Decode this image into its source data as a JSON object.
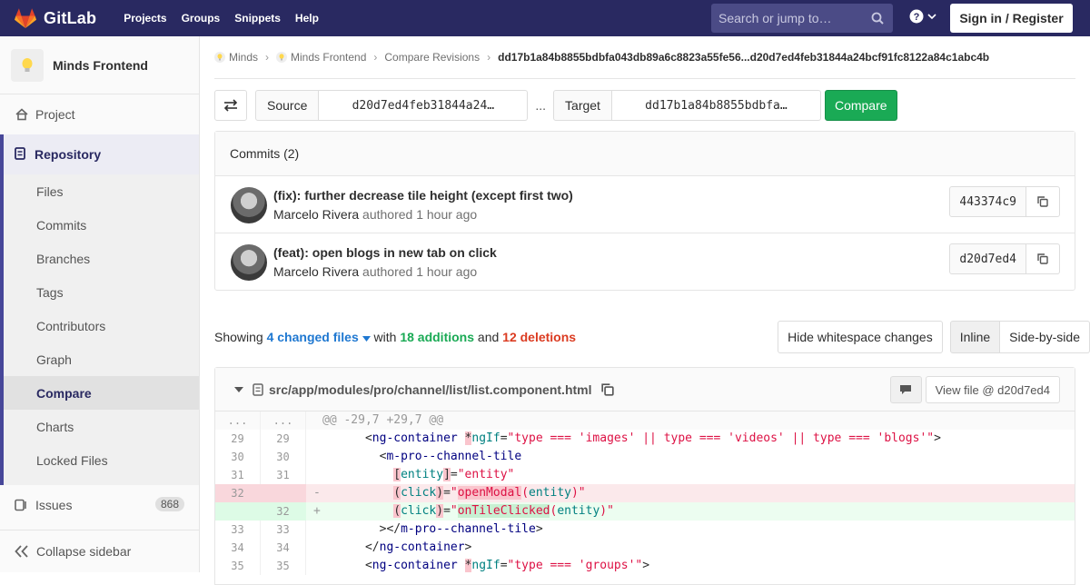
{
  "topbar": {
    "brand": "GitLab",
    "nav": [
      "Projects",
      "Groups",
      "Snippets",
      "Help"
    ],
    "search_placeholder": "Search or jump to…",
    "signin": "Sign in / Register"
  },
  "sidebar": {
    "project_name": "Minds Frontend",
    "project_item": "Project",
    "repository": "Repository",
    "repo_items": [
      "Files",
      "Commits",
      "Branches",
      "Tags",
      "Contributors",
      "Graph",
      "Compare",
      "Charts",
      "Locked Files"
    ],
    "active_item": "Compare",
    "issues": "Issues",
    "issues_count": "868",
    "collapse": "Collapse sidebar"
  },
  "breadcrumb": {
    "items": [
      "Minds",
      "Minds Frontend",
      "Compare Revisions"
    ],
    "current": "dd17b1a84b8855bdbfa043db89a6c8823a55fe56...d20d7ed4feb31844a24bcf91fc8122a84c1abc4b"
  },
  "compare": {
    "source_label": "Source",
    "source_value": "d20d7ed4feb31844a24…",
    "separator": "...",
    "target_label": "Target",
    "target_value": "dd17b1a84b8855bdbfa…",
    "button": "Compare"
  },
  "commits": {
    "header": "Commits (2)",
    "items": [
      {
        "title": "(fix): further decrease tile height (except first two)",
        "author": "Marcelo Rivera",
        "verb": "authored",
        "time": "1 hour ago",
        "sha": "443374c9"
      },
      {
        "title": "(feat): open blogs in new tab on click",
        "author": "Marcelo Rivera",
        "verb": "authored",
        "time": "1 hour ago",
        "sha": "d20d7ed4"
      }
    ]
  },
  "summary": {
    "showing": "Showing",
    "changed_files": "4 changed files",
    "with": "with",
    "additions": "18 additions",
    "and": "and",
    "deletions": "12 deletions",
    "hide_ws": "Hide whitespace changes",
    "inline": "Inline",
    "side_by_side": "Side-by-side"
  },
  "file": {
    "path": "src/app/modules/pro/channel/list/list.component.html",
    "view_file": "View file @ d20d7ed4",
    "hunk_old": "...",
    "hunk_new": "...",
    "hunk_header": "@@ -29,7 +29,7 @@"
  },
  "colors": {
    "topbar": "#292961",
    "accent": "#474799",
    "compare_button": "#1aaa55",
    "additions": "#1aaa55",
    "deletions": "#db3b21",
    "link": "#1f78d1"
  }
}
